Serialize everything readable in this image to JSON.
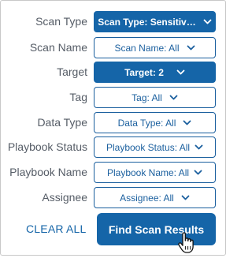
{
  "filters": [
    {
      "label": "Scan Type",
      "value": "Scan Type: Sensitiv…",
      "active": true
    },
    {
      "label": "Scan Name",
      "value": "Scan Name: All",
      "active": false
    },
    {
      "label": "Target",
      "value": "Target: 2",
      "active": true
    },
    {
      "label": "Tag",
      "value": "Tag: All",
      "active": false
    },
    {
      "label": "Data Type",
      "value": "Data Type: All",
      "active": false
    },
    {
      "label": "Playbook Status",
      "value": "Playbook Status: All",
      "active": false
    },
    {
      "label": "Playbook Name",
      "value": "Playbook Name: All",
      "active": false
    },
    {
      "label": "Assignee",
      "value": "Assignee: All",
      "active": false
    }
  ],
  "actions": {
    "clear_all": "CLEAR ALL",
    "find": "Find Scan Results"
  },
  "icons": {
    "dropdown": "chevron-down-icon",
    "cursor": "hand-pointer-icon"
  },
  "colors": {
    "accent": "#1565a8",
    "label": "#555c66",
    "border": "#c8c8c8"
  }
}
